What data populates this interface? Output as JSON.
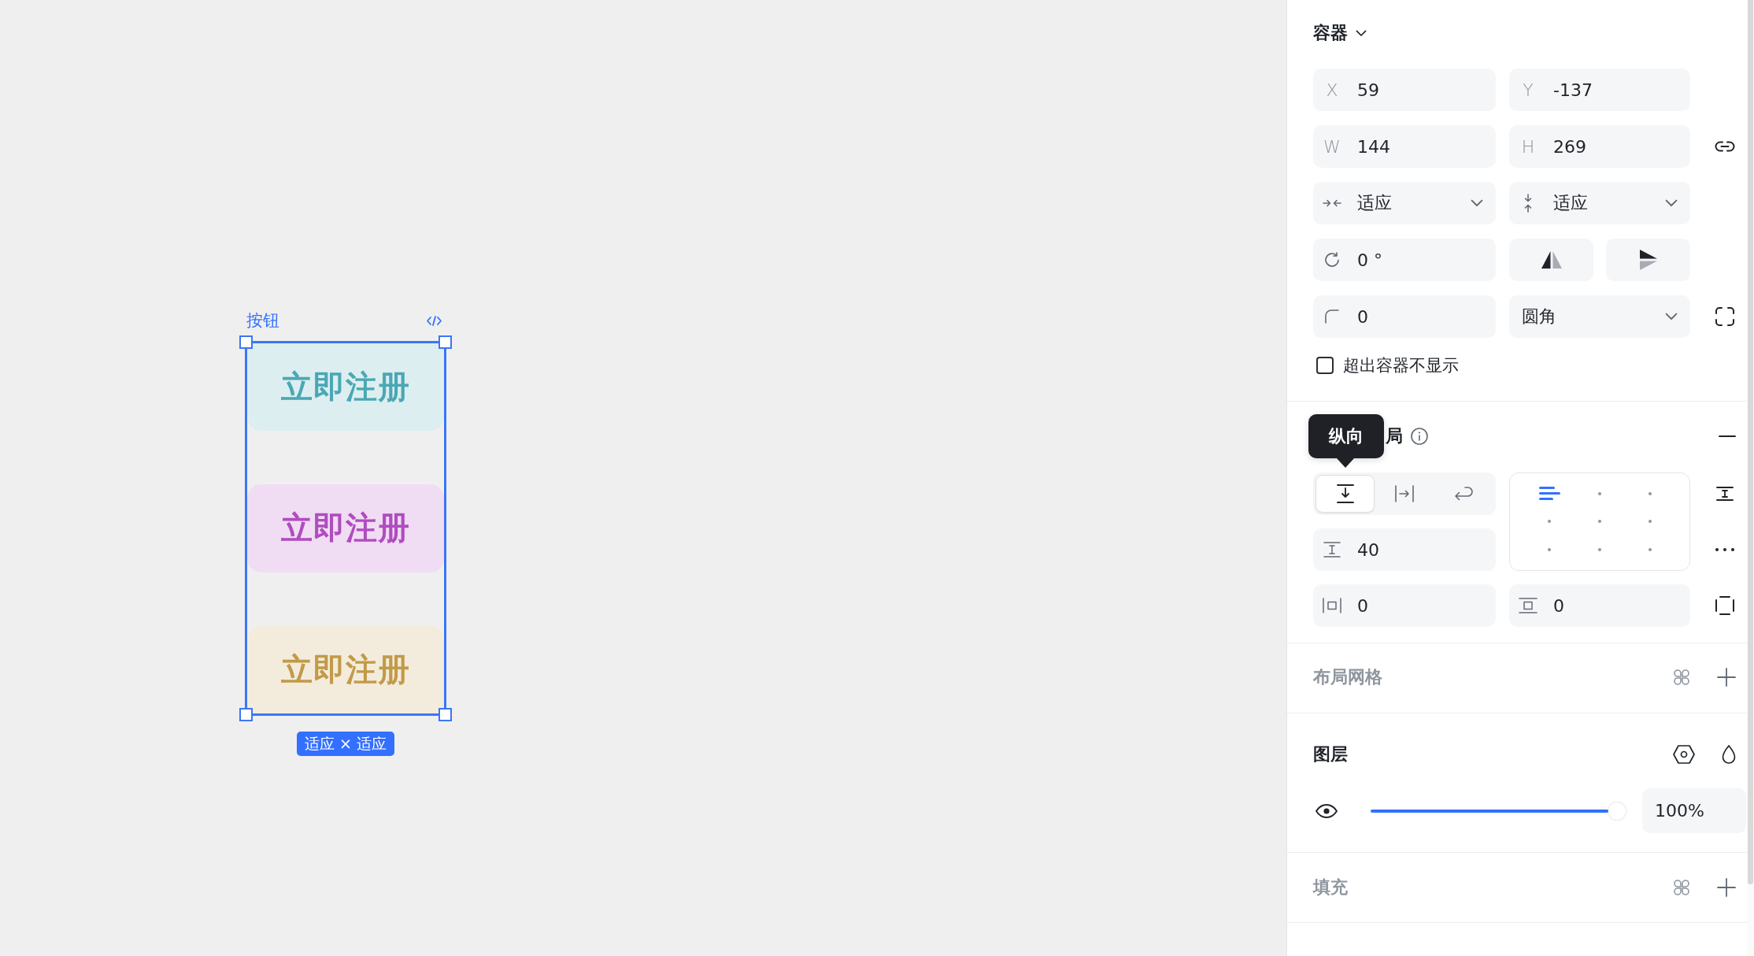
{
  "canvas": {
    "frame": {
      "label": "按钮",
      "buttons": [
        {
          "label": "立即注册",
          "color": "#4aa8b3"
        },
        {
          "label": "立即注册",
          "color": "#b04cc0"
        },
        {
          "label": "立即注册",
          "color": "#c29a48"
        }
      ],
      "size_badge": "适应 × 适应"
    }
  },
  "panel": {
    "container": {
      "title": "容器",
      "position": [
        {
          "label": "X",
          "value": "59"
        },
        {
          "label": "Y",
          "value": "-137"
        }
      ],
      "size": [
        {
          "label": "W",
          "value": "144"
        },
        {
          "label": "H",
          "value": "269"
        }
      ],
      "resizing": [
        {
          "kind": "horizontal",
          "value": "适应"
        },
        {
          "kind": "vertical",
          "value": "适应"
        }
      ],
      "rotation": "0 °",
      "corner_radius": "0",
      "corner_type": "圆角",
      "clip_content": {
        "label": "超出容器不显示",
        "checked": false
      }
    },
    "auto_layout": {
      "title": "局",
      "tooltip": "纵向",
      "directions": [
        {
          "kind": "vertical",
          "selected": true
        },
        {
          "kind": "horizontal",
          "selected": false
        },
        {
          "kind": "wrap",
          "selected": false
        }
      ],
      "alignment": [
        {
          "selected": true
        },
        {
          "selected": false
        },
        {
          "selected": false
        },
        {
          "selected": false
        },
        {
          "selected": false
        },
        {
          "selected": false
        },
        {
          "selected": false
        },
        {
          "selected": false
        },
        {
          "selected": false
        }
      ],
      "gap": "40",
      "padding": [
        {
          "kind": "horizontal",
          "value": "0"
        },
        {
          "kind": "vertical",
          "value": "0"
        }
      ]
    },
    "layout_grid": {
      "title": "布局网格",
      "empty": true
    },
    "layer": {
      "title": "图层",
      "empty": false,
      "visible": true,
      "opacity": {
        "level": 1,
        "value": "100%"
      }
    },
    "fill": {
      "title": "填充",
      "empty": true
    }
  }
}
